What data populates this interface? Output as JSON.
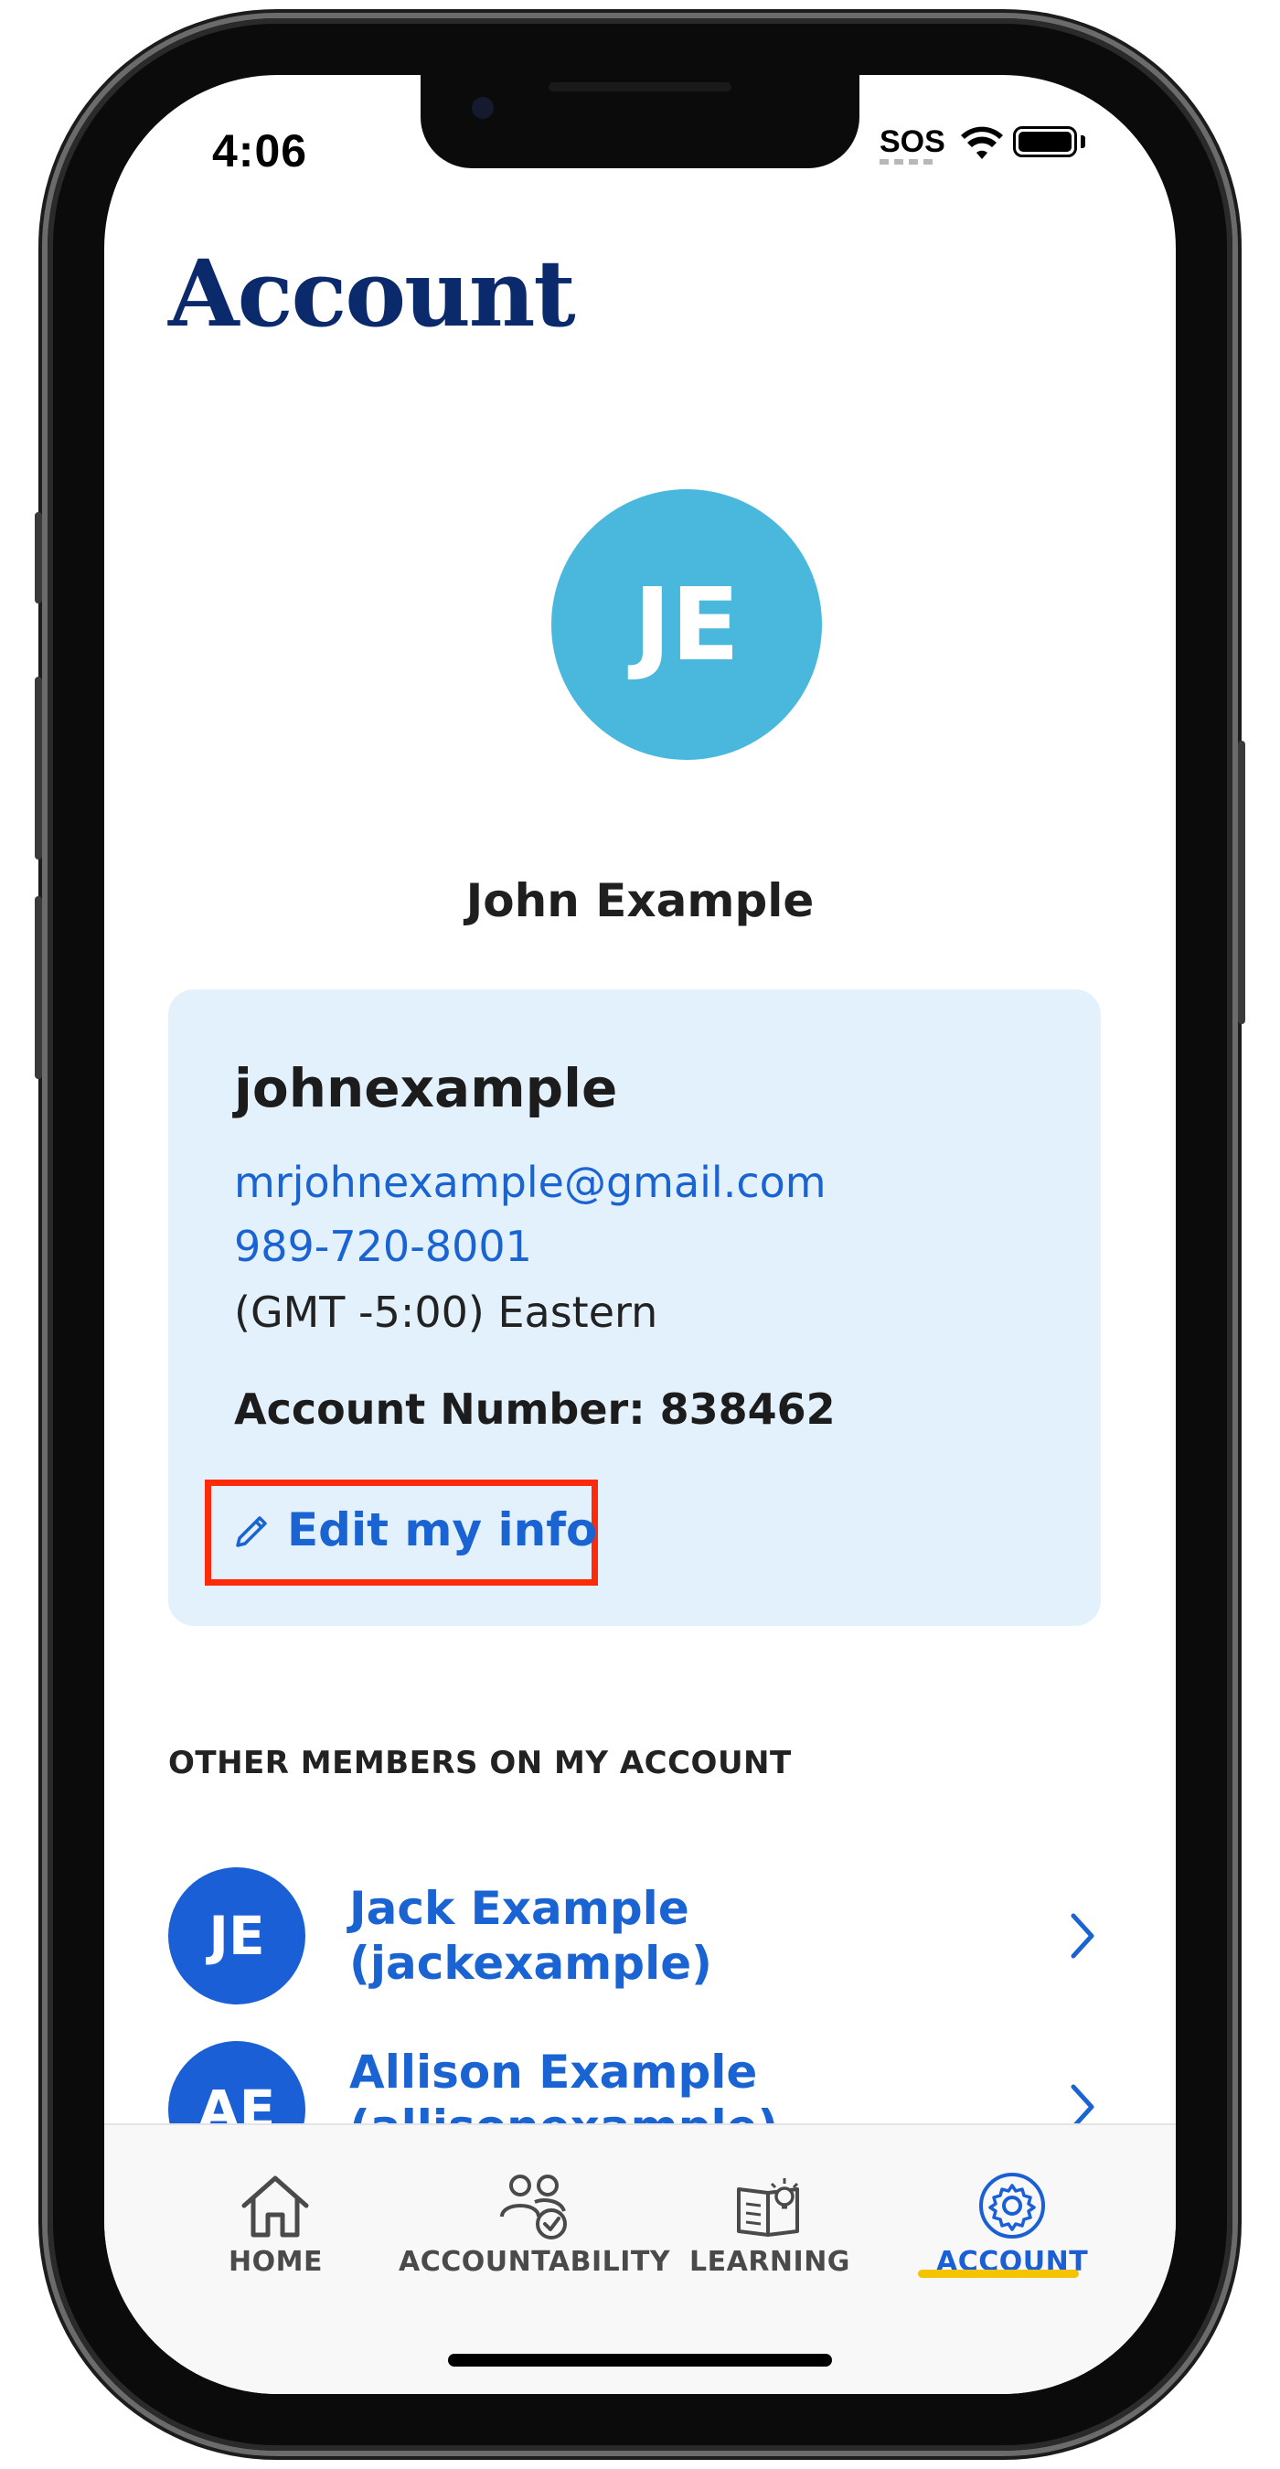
{
  "status_bar": {
    "time": "4:06",
    "sos": "SOS"
  },
  "page": {
    "title": "Account"
  },
  "profile": {
    "initials": "JE",
    "full_name": "John Example",
    "avatar_color": "#4ab8dc"
  },
  "info_card": {
    "username": "johnexample",
    "email": "mrjohnexample@gmail.com",
    "phone": "989-720-8001",
    "timezone": "(GMT -5:00) Eastern",
    "account_number": "Account Number: 838462",
    "edit_label": "Edit my info",
    "edit_icon": "pencil-icon"
  },
  "members": {
    "section_label": "OTHER MEMBERS ON MY ACCOUNT",
    "items": [
      {
        "initials": "JE",
        "name": "Jack Example (jackexample)"
      },
      {
        "initials": "AE",
        "name": "Allison Example (allisonexample)"
      }
    ]
  },
  "tabs": [
    {
      "label": "HOME",
      "icon": "home-icon",
      "active": false
    },
    {
      "label": "ACCOUNTABILITY",
      "icon": "people-check-icon",
      "active": false
    },
    {
      "label": "LEARNING",
      "icon": "book-lightbulb-icon",
      "active": false
    },
    {
      "label": "ACCOUNT",
      "icon": "gear-icon",
      "active": true
    }
  ],
  "colors": {
    "title": "#0b2a6b",
    "link": "#1a63d3",
    "member_avatar": "#1a5fd6",
    "card_bg": "#e3f1fc",
    "highlight_box": "#ff2a0a",
    "tab_active_underline": "#f5c400"
  }
}
